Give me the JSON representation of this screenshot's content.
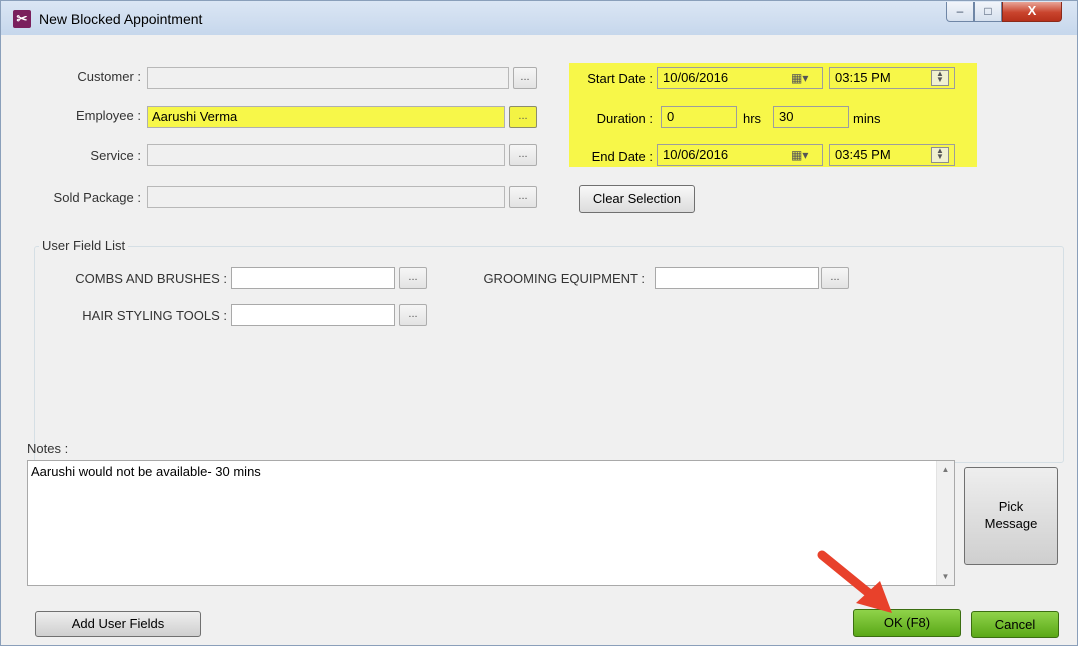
{
  "window": {
    "title": "New Blocked Appointment",
    "icon": "scissors-app-icon",
    "min_glyph": "–",
    "max_glyph": "□",
    "close_glyph": "X"
  },
  "form": {
    "customer": {
      "label": "Customer :",
      "value": "",
      "browse": "..."
    },
    "employee": {
      "label": "Employee :",
      "value": "Aarushi Verma",
      "browse": "..."
    },
    "service": {
      "label": "Service :",
      "value": "",
      "browse": "..."
    },
    "sold_package": {
      "label": "Sold Package :",
      "value": "",
      "browse": "..."
    }
  },
  "schedule": {
    "start_label": "Start Date :",
    "start_date": "10/06/2016",
    "start_time": "03:15 PM",
    "duration_label": "Duration :",
    "hours": "0",
    "hrs_label": "hrs",
    "minutes": "30",
    "mins_label": "mins",
    "end_label": "End Date :",
    "end_date": "10/06/2016",
    "end_time": "03:45 PM",
    "calendar_glyph": "▦▾",
    "highlight_color": "#f7f749"
  },
  "clear_selection": "Clear Selection",
  "user_fields": {
    "title": "User Field List",
    "combs_label": "COMBS AND BRUSHES :",
    "combs_value": "",
    "grooming_label": "GROOMING EQUIPMENT :",
    "grooming_value": "",
    "hair_label": "HAIR STYLING TOOLS :",
    "hair_value": "",
    "browse": "..."
  },
  "notes": {
    "label": "Notes :",
    "value": "Aarushi would not be available- 30 mins",
    "scroll_up": "▲",
    "scroll_down": "▼"
  },
  "buttons": {
    "pick_message": "Pick\nMessage",
    "add_user_fields": "Add User Fields",
    "ok": "OK (F8)",
    "cancel": "Cancel",
    "ok_color": "#6dba2c"
  },
  "annotation": {
    "arrow_color": "#e8412b"
  }
}
